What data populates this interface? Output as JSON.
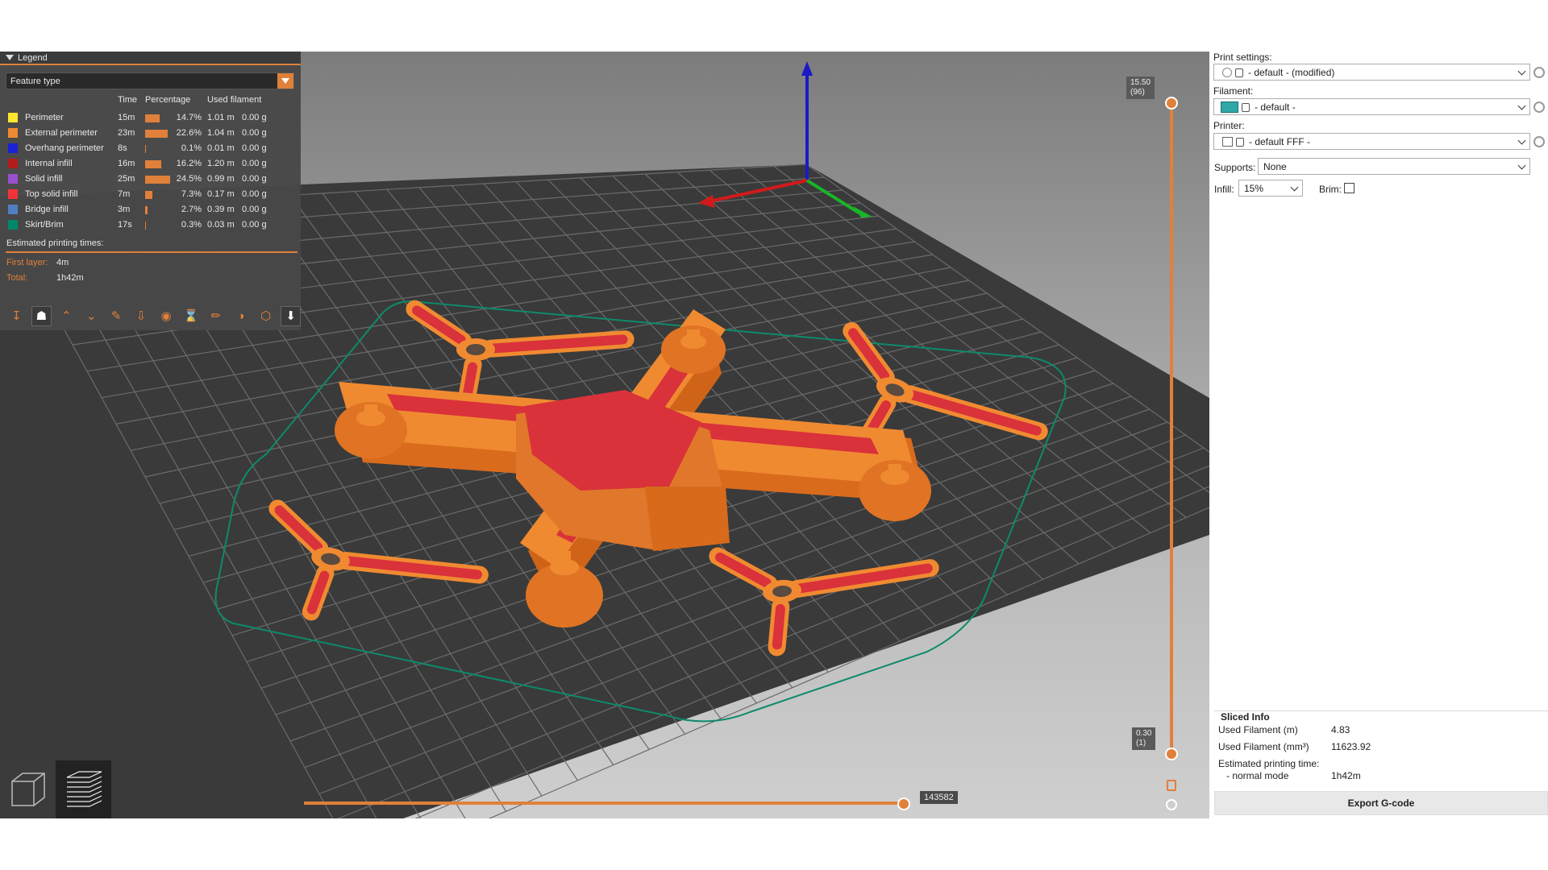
{
  "legend": {
    "title": "Legend",
    "view_type": "Feature type",
    "columns": {
      "time": "Time",
      "percentage": "Percentage",
      "used_filament": "Used filament"
    },
    "rows": [
      {
        "name": "Perimeter",
        "color": "#ffe62e",
        "time": "15m",
        "pct_value": 14.7,
        "pct": "14.7%",
        "length": "1.01 m",
        "weight": "0.00 g"
      },
      {
        "name": "External perimeter",
        "color": "#f08a31",
        "time": "23m",
        "pct_value": 22.6,
        "pct": "22.6%",
        "length": "1.04 m",
        "weight": "0.00 g"
      },
      {
        "name": "Overhang perimeter",
        "color": "#1c22d6",
        "time": "8s",
        "pct_value": 0.1,
        "pct": "0.1%",
        "length": "0.01 m",
        "weight": "0.00 g"
      },
      {
        "name": "Internal infill",
        "color": "#b31c1c",
        "time": "16m",
        "pct_value": 16.2,
        "pct": "16.2%",
        "length": "1.20 m",
        "weight": "0.00 g"
      },
      {
        "name": "Solid infill",
        "color": "#9a4fcd",
        "time": "25m",
        "pct_value": 24.5,
        "pct": "24.5%",
        "length": "0.99 m",
        "weight": "0.00 g"
      },
      {
        "name": "Top solid infill",
        "color": "#f2333a",
        "time": "7m",
        "pct_value": 7.3,
        "pct": "7.3%",
        "length": "0.17 m",
        "weight": "0.00 g"
      },
      {
        "name": "Bridge infill",
        "color": "#4f7fc0",
        "time": "3m",
        "pct_value": 2.7,
        "pct": "2.7%",
        "length": "0.39 m",
        "weight": "0.00 g"
      },
      {
        "name": "Skirt/Brim",
        "color": "#00876b",
        "time": "17s",
        "pct_value": 0.3,
        "pct": "0.3%",
        "length": "0.03 m",
        "weight": "0.00 g"
      }
    ],
    "estimated_title": "Estimated printing times:",
    "first_layer_label": "First layer:",
    "first_layer_value": "4m",
    "total_label": "Total:",
    "total_value": "1h42m",
    "toolbar_icons": [
      "travel-icon",
      "wipe-icon",
      "retractions-icon",
      "deretractions-icon",
      "seams-icon",
      "tool-changes-icon",
      "color-changes-icon",
      "pause-icon",
      "custom-gcode-icon",
      "center-of-gravity-icon",
      "shells-icon",
      "tool-marker-icon"
    ]
  },
  "viewport": {
    "top_layer_height": "15.50",
    "top_layer_index": "(96)",
    "bottom_layer_height": "0.30",
    "bottom_layer_index": "(1)",
    "move_index": "143582",
    "axis_colors": {
      "x": "#d21a1a",
      "y": "#19b429",
      "z": "#1a1ac8"
    },
    "skirt_color": "#00876b",
    "model_color": "#f08a31",
    "top_color": "#d9323a"
  },
  "sidebar": {
    "print_settings_label": "Print settings:",
    "print_settings_value": "- default - (modified)",
    "filament_label": "Filament:",
    "filament_value": "- default -",
    "filament_color": "#2fa7a7",
    "printer_label": "Printer:",
    "printer_value": "- default FFF -",
    "supports_label": "Supports:",
    "supports_value": "None",
    "infill_label": "Infill:",
    "infill_value": "15%",
    "brim_label": "Brim:",
    "brim_checked": false
  },
  "sliced_info": {
    "title": "Sliced Info",
    "used_filament_m_label": "Used Filament (m)",
    "used_filament_m_value": "4.83",
    "used_filament_mm3_label": "Used Filament (mm³)",
    "used_filament_mm3_value": "11623.92",
    "est_time_label": "Estimated printing time:",
    "normal_mode_label": "- normal mode",
    "normal_mode_value": "1h42m"
  },
  "export_button": "Export G-code"
}
